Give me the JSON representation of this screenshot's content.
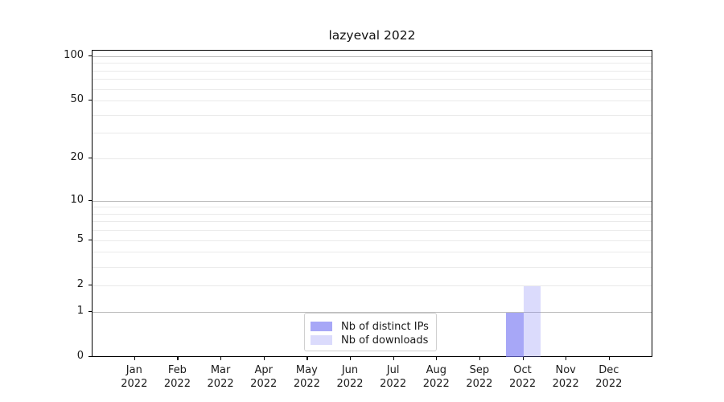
{
  "chart_data": {
    "type": "bar",
    "title": "lazyeval 2022",
    "categories": [
      "Jan\n2022",
      "Feb\n2022",
      "Mar\n2022",
      "Apr\n2022",
      "May\n2022",
      "Jun\n2022",
      "Jul\n2022",
      "Aug\n2022",
      "Sep\n2022",
      "Oct\n2022",
      "Nov\n2022",
      "Dec\n2022"
    ],
    "series": [
      {
        "name": "Nb of distinct IPs",
        "color": "rgba(121,121,243,0.66)",
        "values": [
          0,
          0,
          0,
          0,
          0,
          0,
          0,
          0,
          0,
          1,
          0,
          0
        ]
      },
      {
        "name": "Nb of downloads",
        "color": "rgba(121,121,243,0.27)",
        "values": [
          0,
          0,
          0,
          0,
          0,
          0,
          0,
          0,
          0,
          2,
          0,
          0
        ]
      }
    ],
    "xlabel": "",
    "ylabel": "",
    "yscale": "log1p",
    "ylim": [
      0,
      110
    ],
    "yticks": [
      0,
      1,
      2,
      5,
      10,
      20,
      50,
      100
    ],
    "grid": {
      "major_values": [
        1,
        10,
        100
      ],
      "minor_values": [
        2,
        3,
        4,
        5,
        6,
        7,
        8,
        9,
        20,
        30,
        40,
        50,
        60,
        70,
        80,
        90
      ]
    },
    "legend_position": "lower center",
    "colors": {
      "grid_major": "#bdbdbd",
      "grid_minor": "#eaeaea",
      "spine": "#000000",
      "text": "#1a1a1a",
      "legend_border": "#d0d0d0"
    }
  }
}
